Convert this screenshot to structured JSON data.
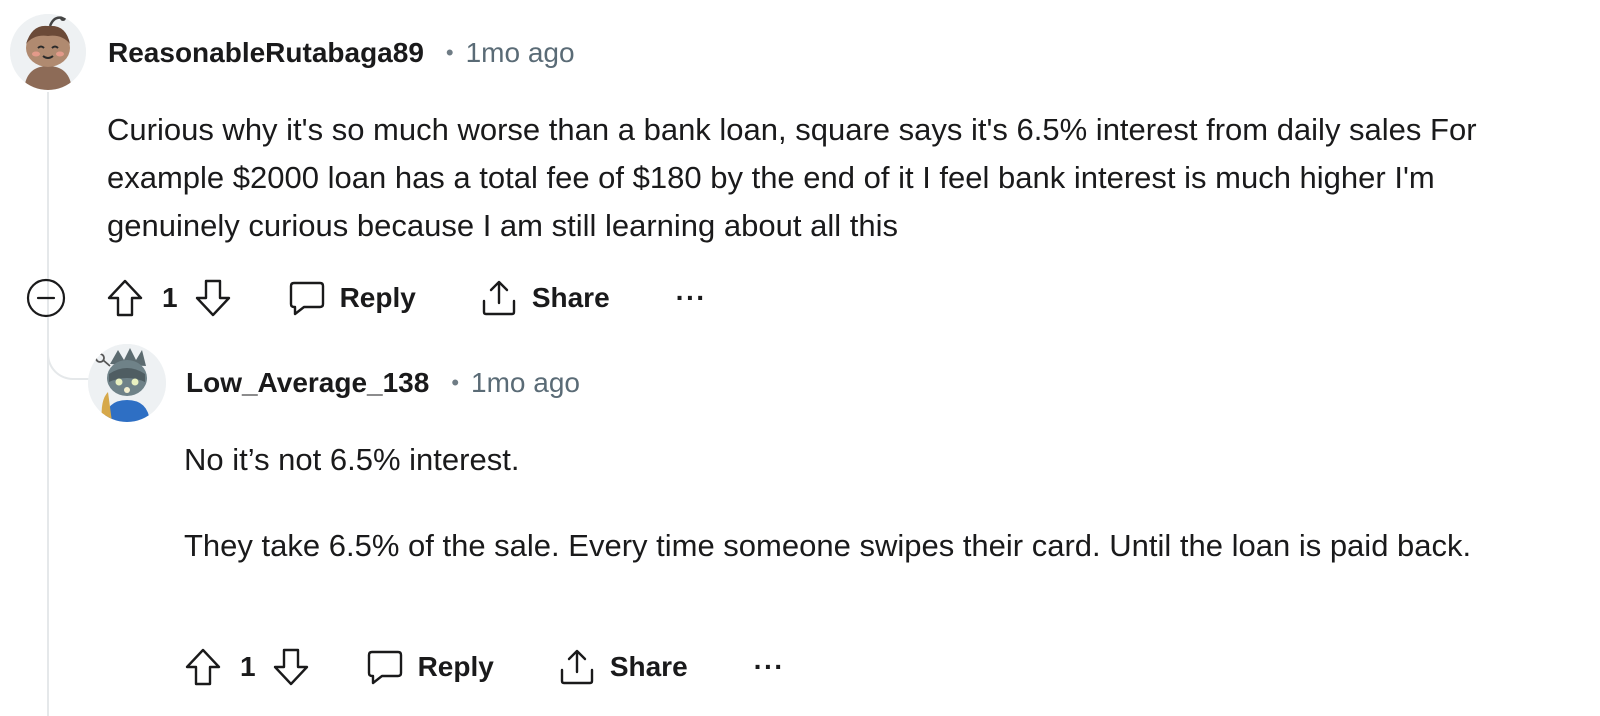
{
  "comments": [
    {
      "username": "ReasonableRutabaga89",
      "separator": "•",
      "time": "1mo ago",
      "body": [
        "Curious why it's so much worse than a bank loan, square says it's 6.5% interest from daily sales For example $2000 loan has a total fee of $180 by the end of it I feel bank interest is much higher I'm genuinely curious because I am still learning about all this"
      ],
      "votes": "1",
      "reply_label": "Reply",
      "share_label": "Share",
      "more_label": "···"
    },
    {
      "username": "Low_Average_138",
      "separator": "•",
      "time": "1mo ago",
      "body": [
        "No it’s not 6.5% interest.",
        "They take 6.5% of the sale. Every time someone swipes their card. Until the loan is paid back."
      ],
      "votes": "1",
      "reply_label": "Reply",
      "share_label": "Share",
      "more_label": "···"
    }
  ],
  "icons": {
    "collapse": "collapse-minus-icon",
    "upvote": "arrow-up-icon",
    "downvote": "arrow-down-icon",
    "reply": "speech-bubble-icon",
    "share": "share-upload-icon",
    "more": "ellipsis-icon"
  },
  "colors": {
    "text": "#1a1a1b",
    "meta": "#5a6b76",
    "thread": "#e5e8ea"
  }
}
